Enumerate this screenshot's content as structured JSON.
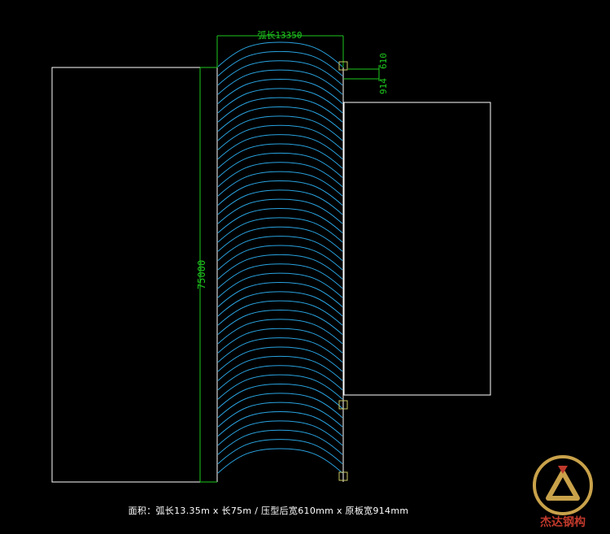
{
  "dimensions": {
    "arc_length": "弧长13350",
    "length": "75000",
    "formed_width": "610",
    "sheet_width": "914"
  },
  "caption": "面积：弧长13.35m x 长75m / 压型后宽610mm x 原板宽914mm",
  "logo": {
    "text": "杰达钢构",
    "icon": "company-logo-icon"
  },
  "colors": {
    "background": "#000000",
    "outline": "#ffffff",
    "dimension": "#1ec81e",
    "panel_arcs": "#29a3e0",
    "snap_marker": "#c8c864",
    "logo_gold": "#c9a24a",
    "logo_red": "#c0392b"
  },
  "panel_arc_count": 45
}
